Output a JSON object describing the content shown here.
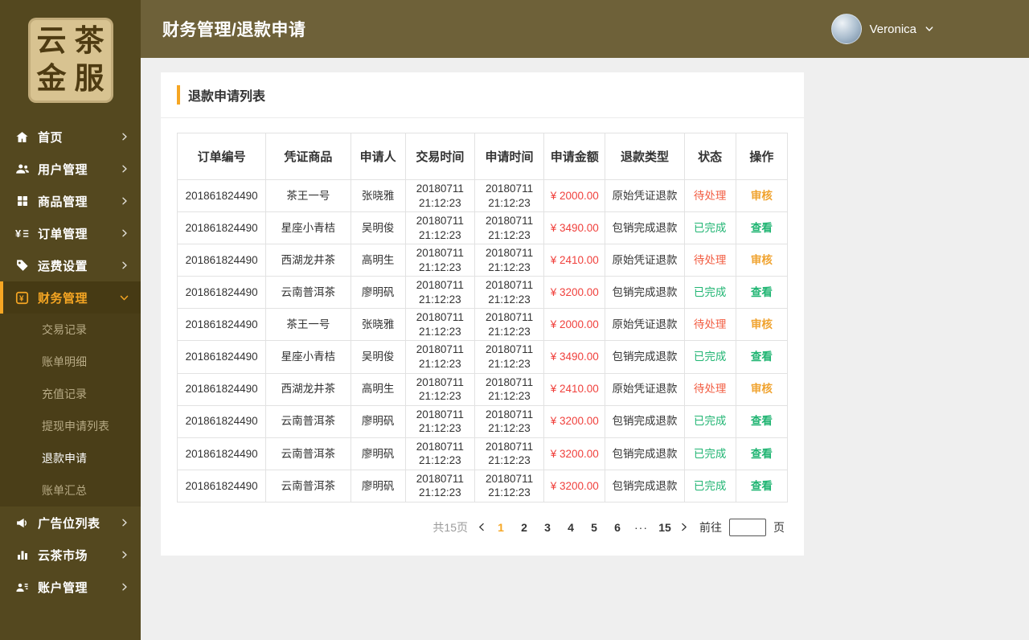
{
  "colors": {
    "accent": "#f6a623",
    "amount_red": "#f0413d",
    "status_pending": "#f25e43",
    "status_done": "#21b573",
    "action_review": "#f0a32f",
    "sidebar_bg": "#54481f",
    "topbar_bg": "#6e6139"
  },
  "logo": {
    "chars": [
      "云",
      "茶",
      "金",
      "服"
    ]
  },
  "header": {
    "title": "财务管理/退款申请",
    "user": {
      "name": "Veronica"
    }
  },
  "sidebar": {
    "items": [
      {
        "id": "home",
        "icon": "home-icon",
        "label": "首页"
      },
      {
        "id": "users",
        "icon": "users-icon",
        "label": "用户管理"
      },
      {
        "id": "products",
        "icon": "grid-icon",
        "label": "商品管理"
      },
      {
        "id": "orders",
        "icon": "order-icon",
        "label": "订单管理"
      },
      {
        "id": "shipping",
        "icon": "tag-icon",
        "label": "运费设置"
      },
      {
        "id": "finance",
        "icon": "finance-icon",
        "label": "财务管理",
        "active": true,
        "expanded": true,
        "children": [
          {
            "id": "transaction-records",
            "label": "交易记录"
          },
          {
            "id": "bill-details",
            "label": "账单明细"
          },
          {
            "id": "recharge-records",
            "label": "充值记录"
          },
          {
            "id": "withdrawal-list",
            "label": "提现申请列表"
          },
          {
            "id": "refund-application",
            "label": "退款申请",
            "active": true
          },
          {
            "id": "bill-summary",
            "label": "账单汇总"
          }
        ]
      },
      {
        "id": "ad-slots",
        "icon": "megaphone-icon",
        "label": "广告位列表"
      },
      {
        "id": "tea-market",
        "icon": "chart-icon",
        "label": "云茶市场"
      },
      {
        "id": "account",
        "icon": "account-icon",
        "label": "账户管理"
      }
    ]
  },
  "card": {
    "title": "退款申请列表",
    "table": {
      "headers": [
        "订单编号",
        "凭证商品",
        "申请人",
        "交易时间",
        "申请时间",
        "申请金额",
        "退款类型",
        "状态",
        "操作"
      ],
      "rows": [
        {
          "order_id": "201861824490",
          "product": "茶王一号",
          "applicant": "张晓雅",
          "trade_time": "20180711 21:12:23",
          "apply_time": "20180711 21:12:23",
          "amount": "¥ 2000.00",
          "refund_type": "原始凭证退款",
          "status": "待处理",
          "status_type": "pending",
          "action": "审核"
        },
        {
          "order_id": "201861824490",
          "product": "星座小青桔",
          "applicant": "吴明俊",
          "trade_time": "20180711 21:12:23",
          "apply_time": "20180711 21:12:23",
          "amount": "¥ 3490.00",
          "refund_type": "包销完成退款",
          "status": "已完成",
          "status_type": "done",
          "action": "查看"
        },
        {
          "order_id": "201861824490",
          "product": "西湖龙井茶",
          "applicant": "高明生",
          "trade_time": "20180711 21:12:23",
          "apply_time": "20180711 21:12:23",
          "amount": "¥ 2410.00",
          "refund_type": "原始凭证退款",
          "status": "待处理",
          "status_type": "pending",
          "action": "审核"
        },
        {
          "order_id": "201861824490",
          "product": "云南普洱茶",
          "applicant": "廖明矾",
          "trade_time": "20180711 21:12:23",
          "apply_time": "20180711 21:12:23",
          "amount": "¥ 3200.00",
          "refund_type": "包销完成退款",
          "status": "已完成",
          "status_type": "done",
          "action": "查看"
        },
        {
          "order_id": "201861824490",
          "product": "茶王一号",
          "applicant": "张晓雅",
          "trade_time": "20180711 21:12:23",
          "apply_time": "20180711 21:12:23",
          "amount": "¥ 2000.00",
          "refund_type": "原始凭证退款",
          "status": "待处理",
          "status_type": "pending",
          "action": "审核"
        },
        {
          "order_id": "201861824490",
          "product": "星座小青桔",
          "applicant": "吴明俊",
          "trade_time": "20180711 21:12:23",
          "apply_time": "20180711 21:12:23",
          "amount": "¥ 3490.00",
          "refund_type": "包销完成退款",
          "status": "已完成",
          "status_type": "done",
          "action": "查看"
        },
        {
          "order_id": "201861824490",
          "product": "西湖龙井茶",
          "applicant": "高明生",
          "trade_time": "20180711 21:12:23",
          "apply_time": "20180711 21:12:23",
          "amount": "¥ 2410.00",
          "refund_type": "原始凭证退款",
          "status": "待处理",
          "status_type": "pending",
          "action": "审核"
        },
        {
          "order_id": "201861824490",
          "product": "云南普洱茶",
          "applicant": "廖明矾",
          "trade_time": "20180711 21:12:23",
          "apply_time": "20180711 21:12:23",
          "amount": "¥ 3200.00",
          "refund_type": "包销完成退款",
          "status": "已完成",
          "status_type": "done",
          "action": "查看"
        },
        {
          "order_id": "201861824490",
          "product": "云南普洱茶",
          "applicant": "廖明矾",
          "trade_time": "20180711 21:12:23",
          "apply_time": "20180711 21:12:23",
          "amount": "¥ 3200.00",
          "refund_type": "包销完成退款",
          "status": "已完成",
          "status_type": "done",
          "action": "查看"
        },
        {
          "order_id": "201861824490",
          "product": "云南普洱茶",
          "applicant": "廖明矾",
          "trade_time": "20180711 21:12:23",
          "apply_time": "20180711 21:12:23",
          "amount": "¥ 3200.00",
          "refund_type": "包销完成退款",
          "status": "已完成",
          "status_type": "done",
          "action": "查看"
        }
      ]
    },
    "pagination": {
      "total_label": "共15页",
      "pages": [
        "1",
        "2",
        "3",
        "4",
        "5",
        "6",
        "···",
        "15"
      ],
      "current_page": "1",
      "goto_label": "前往",
      "goto_value": "",
      "page_suffix": "页"
    }
  }
}
